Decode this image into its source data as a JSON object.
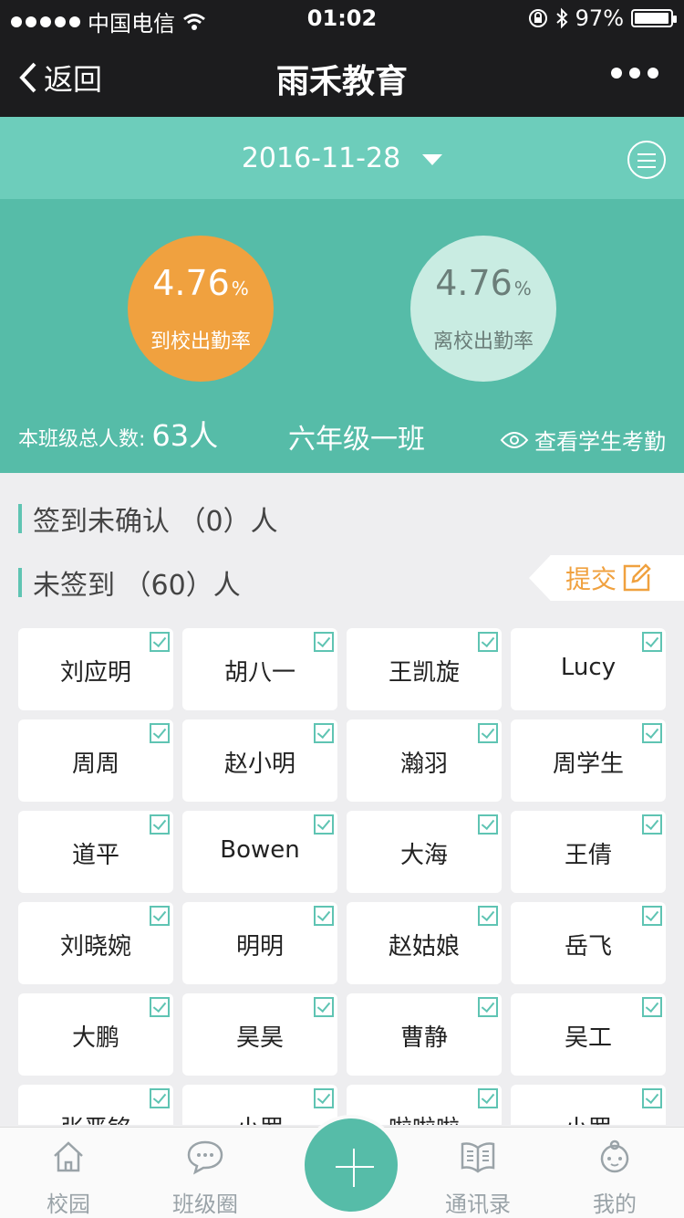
{
  "status_bar": {
    "carrier": "中国电信",
    "time": "01:02",
    "battery": "97%",
    "battery_level": 0.97
  },
  "nav": {
    "back_label": "返回",
    "title": "雨禾教育"
  },
  "date_bar": {
    "date": "2016-11-28"
  },
  "stats": {
    "arrive_rate": "4.76",
    "arrive_label": "到校出勤率",
    "leave_rate": "4.76",
    "leave_label": "离校出勤率",
    "percent_sign": "%",
    "total_label": "本班级总人数:",
    "total_count": "63人",
    "class_name": "六年级一班",
    "view_label": "查看学生考勤"
  },
  "sections": {
    "unconfirmed": "签到未确认 （0）人",
    "not_signed": "未签到 （60）人",
    "submit_label": "提交"
  },
  "students": [
    "刘应明",
    "胡八一",
    "王凯旋",
    "Lucy",
    "周周",
    "赵小明",
    "瀚羽",
    "周学生",
    "道平",
    "Bowen",
    "大海",
    "王倩",
    "刘晓婉",
    "明明",
    "赵姑娘",
    "岳飞",
    "大鹏",
    "昊昊",
    "曹静",
    "吴工",
    "张晋铭",
    "小罗",
    "啦啦啦",
    "小罗"
  ],
  "tabs": [
    {
      "label": "校园",
      "icon": "house-icon"
    },
    {
      "label": "班级圈",
      "icon": "chat-bubble-icon"
    },
    {
      "label": "通讯录",
      "icon": "book-icon"
    },
    {
      "label": "我的",
      "icon": "profile-icon"
    }
  ],
  "colors": {
    "primary": "#56bca8",
    "accent": "#f0a13f",
    "header": "#1c1c1e"
  }
}
